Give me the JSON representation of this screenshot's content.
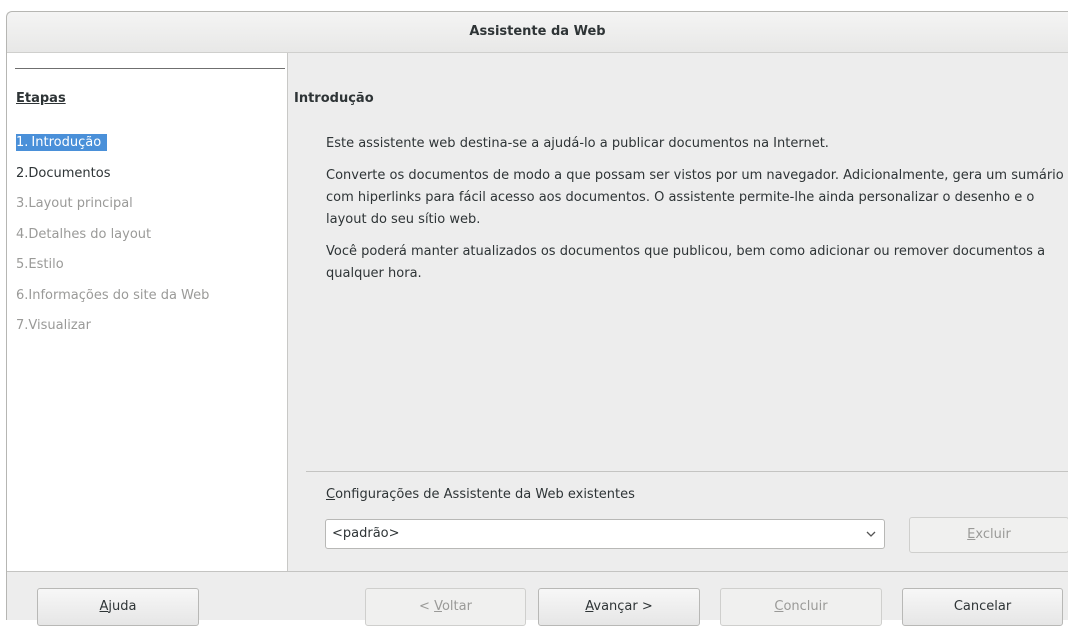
{
  "window": {
    "title": "Assistente da Web"
  },
  "steps": {
    "heading": "Etapas",
    "items": [
      {
        "num": "1.",
        "label": "Introdução",
        "state": "current"
      },
      {
        "num": "2.",
        "label": "Documentos",
        "state": "enabled"
      },
      {
        "num": "3.",
        "label": "Layout principal",
        "state": "disabled"
      },
      {
        "num": "4.",
        "label": "Detalhes do layout",
        "state": "disabled"
      },
      {
        "num": "5.",
        "label": "Estilo",
        "state": "disabled"
      },
      {
        "num": "6.",
        "label": "Informações do site da Web",
        "state": "disabled"
      },
      {
        "num": "7.",
        "label": "Visualizar",
        "state": "disabled"
      }
    ]
  },
  "page": {
    "heading": "Introdução",
    "paragraphs": [
      "Este assistente web destina-se a ajudá-lo a publicar documentos na Internet.",
      "Converte os documentos de modo a que possam ser vistos por um navegador. Adicionalmente, gera um sumário com hiperlinks para fácil acesso aos documentos. O assistente permite-lhe ainda personalizar o desenho e o layout do seu sítio web.",
      "Você poderá manter atualizados os documentos que publicou, bem como adicionar ou remover documentos a qualquer hora."
    ],
    "config_label_mnemonic": "C",
    "config_label_rest": "onfigurações de Assistente da Web existentes",
    "config_value": "<padrão>",
    "delete_mnemonic": "E",
    "delete_rest": "xcluir"
  },
  "buttons": {
    "help_mnemonic": "A",
    "help_rest": "juda",
    "back_prefix": "< ",
    "back_mnemonic": "V",
    "back_rest": "oltar",
    "next_mnemonic": "A",
    "next_rest": "vançar >",
    "finish_mnemonic": "C",
    "finish_rest": "oncluir",
    "cancel": "Cancelar"
  }
}
